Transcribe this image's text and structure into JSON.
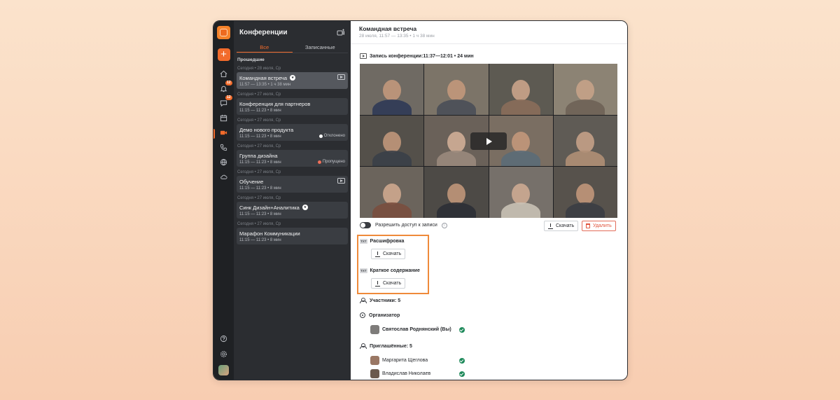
{
  "sidebar": {
    "title": "Конференции",
    "tabs": [
      {
        "label": "Все"
      },
      {
        "label": "Записанные"
      }
    ],
    "section_label": "Прошедшие",
    "badges": {
      "notifications": "12",
      "chats": "12"
    }
  },
  "conferences": [
    {
      "date": "Сегодня • 28 июля, Ср",
      "title": "Командная встреча",
      "meta": "11:57 — 13:35 • 1 ч 38 мин",
      "status": ""
    },
    {
      "date": "Сегодня • 27 июля, Ср",
      "title": "Конференция для партнеров",
      "meta": "11:15 — 11:23 • 8 мин",
      "status": ""
    },
    {
      "date": "Сегодня • 27 июля, Ср",
      "title": "Демо нового продукта",
      "meta": "11:15 — 11:23 • 8 мин",
      "status": "Отклонено"
    },
    {
      "date": "Сегодня • 27 июля, Ср",
      "title": "Группа дизайна",
      "meta": "11:15 — 11:23 • 8 мин",
      "status": "Пропущено"
    },
    {
      "date": "Сегодня • 27 июля, Ср",
      "title": "Обучение",
      "meta": "11:15 — 11:23 • 8 мин",
      "status": ""
    },
    {
      "date": "Сегодня • 27 июля, Ср",
      "title": "Синк Дизайн+Аналитика",
      "meta": "11:15 — 11:23 • 8 мин",
      "status": ""
    },
    {
      "date": "Сегодня • 27 июля, Ср",
      "title": "Марафон Коммуникации",
      "meta": "11:15 — 11:23 • 8 мин",
      "status": ""
    }
  ],
  "main": {
    "title": "Командная встреча",
    "subtitle": "28 июля, 11:57 — 13:35 • 1 ч 38 мин",
    "recording_label": "Запись конференции:11:37—12:01 • 24 мин",
    "allow_access_label": "Разрешить доступ к записи",
    "download_label": "Скачать",
    "delete_label": "Удалить",
    "files": [
      {
        "tag": "TXT",
        "name": "Расшифровка",
        "button": "Скачать"
      },
      {
        "tag": "TXT",
        "name": "Краткое содержание",
        "button": "Скачать"
      }
    ],
    "participants_label": "Участники: 5",
    "organizer_label": "Организатор",
    "organizer_name": "Святослав Роднянский (Вы)",
    "invited_label": "Приглашённые: 5",
    "invited": [
      "Маргарита Щеглова",
      "Владислав Николаев"
    ]
  },
  "colors": {
    "accent": "#f26b2b",
    "success": "#1f8a5b",
    "danger": "#e0533b",
    "highlight": "#ef8a3a"
  }
}
